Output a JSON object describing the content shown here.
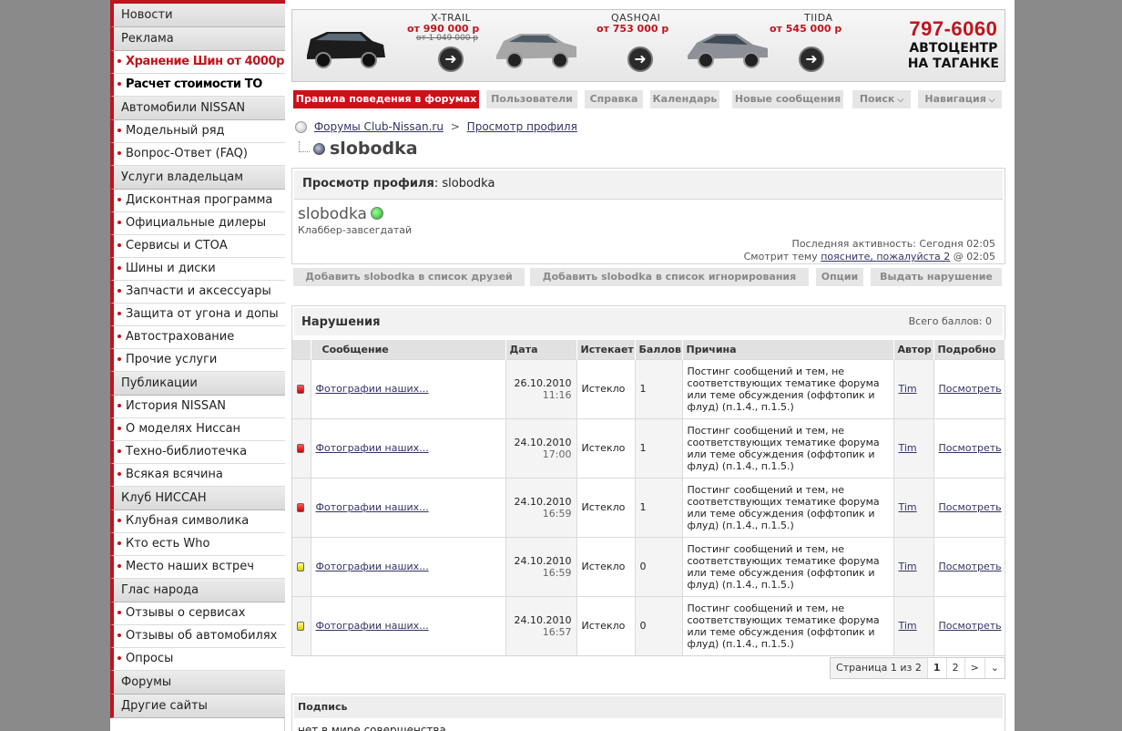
{
  "sidebar": [
    {
      "kind": "sec",
      "label": "Новости"
    },
    {
      "kind": "sec",
      "label": "Реклама"
    },
    {
      "kind": "hot",
      "label": "Хранение Шин от 4000р."
    },
    {
      "kind": "bold",
      "label": "Расчет стоимости ТО"
    },
    {
      "kind": "sec",
      "label": "Автомобили NISSAN"
    },
    {
      "kind": "item",
      "label": "Модельный ряд"
    },
    {
      "kind": "item",
      "label": "Вопрос-Ответ (FAQ)"
    },
    {
      "kind": "sec",
      "label": "Услуги владельцам"
    },
    {
      "kind": "item",
      "label": "Дисконтная программа"
    },
    {
      "kind": "item",
      "label": "Официальные дилеры"
    },
    {
      "kind": "item",
      "label": "Сервисы и СТОА"
    },
    {
      "kind": "item",
      "label": "Шины и диски"
    },
    {
      "kind": "item",
      "label": "Запчасти и аксессуары"
    },
    {
      "kind": "item",
      "label": "Защита от угона и допы"
    },
    {
      "kind": "item",
      "label": "Автострахование"
    },
    {
      "kind": "item",
      "label": "Прочие услуги"
    },
    {
      "kind": "sec",
      "label": "Публикации"
    },
    {
      "kind": "item",
      "label": "История NISSAN"
    },
    {
      "kind": "item",
      "label": "О моделях Ниссан"
    },
    {
      "kind": "item",
      "label": "Техно-библиотечка"
    },
    {
      "kind": "item",
      "label": "Всякая всячина"
    },
    {
      "kind": "sec",
      "label": "Клуб НИССАН"
    },
    {
      "kind": "item",
      "label": "Клубная символика"
    },
    {
      "kind": "item",
      "label": "Кто есть Who"
    },
    {
      "kind": "item",
      "label": "Место наших встреч"
    },
    {
      "kind": "sec",
      "label": "Глас народа"
    },
    {
      "kind": "item",
      "label": "Отзывы о сервисах"
    },
    {
      "kind": "item",
      "label": "Отзывы об автомобилях"
    },
    {
      "kind": "item",
      "label": "Опросы"
    },
    {
      "kind": "sec",
      "label": "Форумы"
    },
    {
      "kind": "sec",
      "label": "Другие сайты"
    }
  ],
  "banner": {
    "cars": [
      {
        "name": "X-TRAIL",
        "price": "от 990 000 р",
        "old": "от 1 049 000 р",
        "color": "#1a1a1a"
      },
      {
        "name": "QASHQAI",
        "price": "от 753 000 р",
        "old": "",
        "color": "#9a9a9a"
      },
      {
        "name": "TIIDA",
        "price": "от 545 000 р",
        "old": "",
        "color": "#8c8f94"
      }
    ],
    "phone": "797-6060",
    "dealer_line1": "АВТОЦЕНТР",
    "dealer_line2": "НА ТАГАНКЕ"
  },
  "navbar": {
    "rules": "Правила поведения в форумах",
    "users": "Пользователи",
    "help": "Справка",
    "calendar": "Календарь",
    "new": "Новые сообщения",
    "search": "Поиск",
    "navigation": "Навигация"
  },
  "breadcrumb": {
    "root": "Форумы Club-Nissan.ru",
    "sep": ">",
    "current": "Просмотр профиля"
  },
  "page_title": "slobodka",
  "profile": {
    "head_label": "Просмотр профиля",
    "head_user": "slobodka",
    "username": "slobodka",
    "user_title": "Клаббер-завсегдатай",
    "last_activity_label": "Последняя активность:",
    "last_activity_value": "Сегодня 02:05",
    "viewing_label": "Смотрит тему",
    "viewing_link": "поясните, пожалуйста 2",
    "viewing_time": "@ 02:05"
  },
  "actions": {
    "add_friend": "Добавить slobodka в список друзей",
    "add_ignore": "Добавить slobodka в список игнорирования",
    "options": "Опции",
    "infraction": "Выдать нарушение"
  },
  "infractions": {
    "title": "Нарушения",
    "points_label": "Всего баллов: 0",
    "columns": [
      "Сообщение",
      "Дата",
      "Истекает",
      "Баллов",
      "Причина",
      "Автор",
      "Подробно"
    ],
    "rows": [
      {
        "status": "red",
        "message": "Фотографии наших...",
        "date": "26.10.2010",
        "time": "11:16",
        "expires": "Истекло",
        "points": "1",
        "reason": "Постинг сообщений и тем, не соответствующих тематике форума или теме обсуждения (оффтопик и флуд) (п.1.4., п.1.5.)",
        "author": "Tim",
        "details": "Посмотреть"
      },
      {
        "status": "red",
        "message": "Фотографии наших...",
        "date": "24.10.2010",
        "time": "17:00",
        "expires": "Истекло",
        "points": "1",
        "reason": "Постинг сообщений и тем, не соответствующих тематике форума или теме обсуждения (оффтопик и флуд) (п.1.4., п.1.5.)",
        "author": "Tim",
        "details": "Посмотреть"
      },
      {
        "status": "red",
        "message": "Фотографии наших...",
        "date": "24.10.2010",
        "time": "16:59",
        "expires": "Истекло",
        "points": "1",
        "reason": "Постинг сообщений и тем, не соответствующих тематике форума или теме обсуждения (оффтопик и флуд) (п.1.4., п.1.5.)",
        "author": "Tim",
        "details": "Посмотреть"
      },
      {
        "status": "yellow",
        "message": "Фотографии наших...",
        "date": "24.10.2010",
        "time": "16:59",
        "expires": "Истекло",
        "points": "0",
        "reason": "Постинг сообщений и тем, не соответствующих тематике форума или теме обсуждения (оффтопик и флуд) (п.1.4., п.1.5.)",
        "author": "Tim",
        "details": "Посмотреть"
      },
      {
        "status": "yellow",
        "message": "Фотографии наших...",
        "date": "24.10.2010",
        "time": "16:57",
        "expires": "Истекло",
        "points": "0",
        "reason": "Постинг сообщений и тем, не соответствующих тематике форума или теме обсуждения (оффтопик и флуд) (п.1.4., п.1.5.)",
        "author": "Tim",
        "details": "Посмотреть"
      }
    ]
  },
  "pager": {
    "label": "Страница 1 из 2",
    "pages": [
      "1",
      "2"
    ],
    "next": ">"
  },
  "signature": {
    "title": "Подпись",
    "text": "нет в мире совершенства"
  },
  "colors": {
    "accent_red": "#c0141c",
    "nav_active": "#cf0f16"
  }
}
